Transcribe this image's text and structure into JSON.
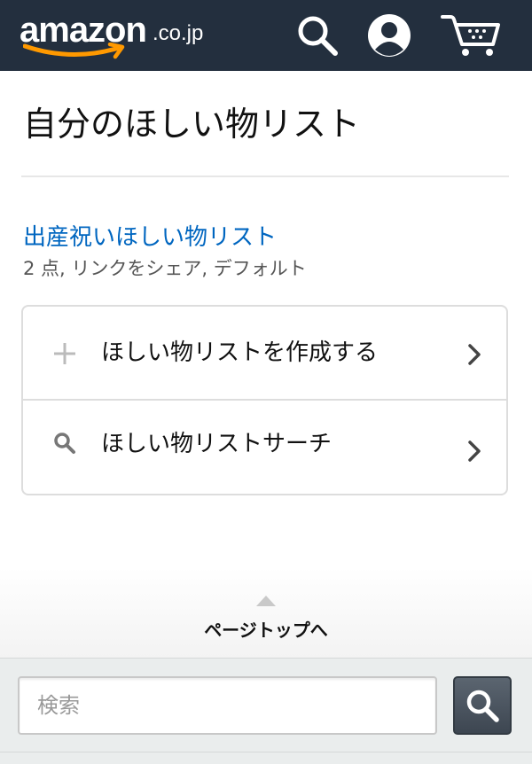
{
  "header": {
    "logo_word": "amazon",
    "logo_tld": ".co.jp",
    "icons": {
      "search": "search-icon",
      "account": "account-icon",
      "cart": "cart-icon"
    },
    "background_color": "#232f3e",
    "smile_color": "#ff9900"
  },
  "page": {
    "title": "自分のほしい物リスト"
  },
  "wishlist": {
    "name": "出産祝いほしい物リスト",
    "meta": "2 点, リンクをシェア, デフォルト",
    "link_color": "#0066c0"
  },
  "actions": [
    {
      "label": "ほしい物リストを作成する",
      "icon": "plus-icon"
    },
    {
      "label": "ほしい物リストサーチ",
      "icon": "search-icon"
    }
  ],
  "footer": {
    "back_to_top": "ページトップへ"
  },
  "search": {
    "placeholder": "検索",
    "value": ""
  }
}
